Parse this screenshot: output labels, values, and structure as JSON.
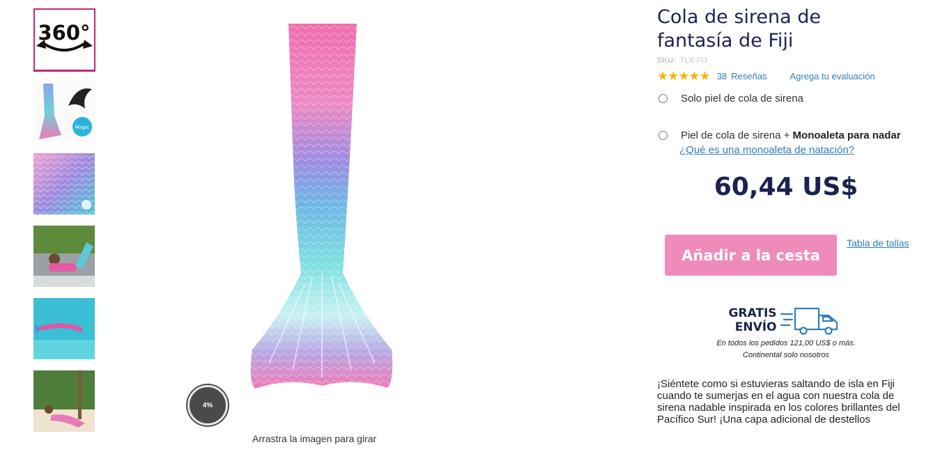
{
  "thumbnails": [
    {
      "name": "360-view",
      "label": "360°"
    },
    {
      "name": "fin-pack"
    },
    {
      "name": "scales-closeup"
    },
    {
      "name": "girl-lounging"
    },
    {
      "name": "underwater-swim"
    },
    {
      "name": "beach-pose"
    }
  ],
  "viewer": {
    "progress_label": "4%",
    "drag_hint": "Arrastra la imagen para girar"
  },
  "product": {
    "title_line1": "Cola de sirena de",
    "title_line2": "fantasía de Fiji",
    "sku_label": "SKU:",
    "sku_value": "TLX-FIJ",
    "stars": "★★★★★",
    "rating_value": 5,
    "review_count": "38",
    "review_label": "Reseñas",
    "add_review": "Agrega tu evaluación",
    "option1": "Solo piel de cola de sirena",
    "option2_prefix": "Piel de cola de sirena + ",
    "option2_bold": "Monoaleta para nadar",
    "fin_link": "¿Qué es una monoaleta de natación?",
    "price": "60,44 US$",
    "add_to_cart": "Añadir a la cesta",
    "size_chart": "Tabla de tallas"
  },
  "shipping": {
    "line1": "GRATIS",
    "line2": "ENVÍO",
    "note1": "En todos los pedidos 121,00 US$ o más.",
    "note2": "Continental solo nosotros",
    "icon": "truck-icon"
  },
  "description": "¡Siéntete como si estuvieras saltando de isla en Fiji cuando te sumerjas en el agua con nuestra cola de sirena nadable inspirada en los colores brillantes del Pacífico Sur! ¡Una capa adicional de destellos",
  "colors": {
    "accent_pink": "#ef8bbb",
    "title_navy": "#1c2250",
    "link_blue": "#2f7fb8",
    "thumb_border": "#c0277a"
  }
}
